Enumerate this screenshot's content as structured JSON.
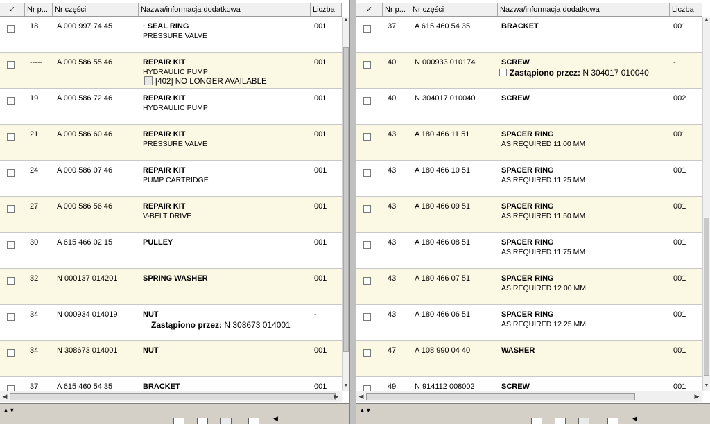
{
  "columns": {
    "check": "✓",
    "pos": "Nr p...",
    "num": "Nr części",
    "name": "Nazwa/informacja dodatkowa",
    "qty": "Liczba"
  },
  "note_label": "Zastąpiono przez:",
  "left_rows": [
    {
      "pos": "18",
      "num": "A 000 997 74 45",
      "name": "· SEAL RING",
      "info": "PRESSURE VALVE",
      "qty": "001"
    },
    {
      "pos": "-----",
      "num": "A 000 586 55 46",
      "name": "REPAIR KIT",
      "info": "HYDRAULIC PUMP",
      "qty": "001",
      "notice": "[402] NO LONGER AVAILABLE"
    },
    {
      "pos": "19",
      "num": "A 000 586 72 46",
      "name": "REPAIR KIT",
      "info": "HYDRAULIC PUMP",
      "qty": "001"
    },
    {
      "pos": "21",
      "num": "A 000 586 60 46",
      "name": "REPAIR KIT",
      "info": "PRESSURE VALVE",
      "qty": "001"
    },
    {
      "pos": "24",
      "num": "A 000 586 07 46",
      "name": "REPAIR KIT",
      "info": "PUMP CARTRIDGE",
      "qty": "001"
    },
    {
      "pos": "27",
      "num": "A 000 586 56 46",
      "name": "REPAIR KIT",
      "info": "V-BELT DRIVE",
      "qty": "001"
    },
    {
      "pos": "30",
      "num": "A 615 466 02 15",
      "name": "PULLEY",
      "info": "",
      "qty": "001"
    },
    {
      "pos": "32",
      "num": "N 000137 014201",
      "name": "SPRING WASHER",
      "info": "",
      "qty": "001"
    },
    {
      "pos": "34",
      "num": "N 000934 014019",
      "name": "NUT",
      "info": "",
      "qty": "-",
      "replaced": "N 308673 014001"
    },
    {
      "pos": "34",
      "num": "N 308673 014001",
      "name": "NUT",
      "info": "",
      "qty": "001"
    },
    {
      "pos": "37",
      "num": "A 615 460 54 35",
      "name": "BRACKET",
      "info": "",
      "qty": "001"
    }
  ],
  "right_rows": [
    {
      "pos": "37",
      "num": "A 615 460 54 35",
      "name": "BRACKET",
      "info": "",
      "qty": "001"
    },
    {
      "pos": "40",
      "num": "N 000933 010174",
      "name": "SCREW",
      "info": "",
      "qty": "-",
      "replaced": "N 304017 010040"
    },
    {
      "pos": "40",
      "num": "N 304017 010040",
      "name": "SCREW",
      "info": "",
      "qty": "002"
    },
    {
      "pos": "43",
      "num": "A 180 466 11 51",
      "name": "SPACER RING",
      "info": "AS REQUIRED 11.00 MM",
      "qty": "001"
    },
    {
      "pos": "43",
      "num": "A 180 466 10 51",
      "name": "SPACER RING",
      "info": "AS REQUIRED 11.25 MM",
      "qty": "001"
    },
    {
      "pos": "43",
      "num": "A 180 466 09 51",
      "name": "SPACER RING",
      "info": "AS REQUIRED 11.50 MM",
      "qty": "001"
    },
    {
      "pos": "43",
      "num": "A 180 466 08 51",
      "name": "SPACER RING",
      "info": "AS REQUIRED 11.75 MM",
      "qty": "001"
    },
    {
      "pos": "43",
      "num": "A 180 466 07 51",
      "name": "SPACER RING",
      "info": "AS REQUIRED 12.00 MM",
      "qty": "001"
    },
    {
      "pos": "43",
      "num": "A 180 466 06 51",
      "name": "SPACER RING",
      "info": "AS REQUIRED 12.25 MM",
      "qty": "001"
    },
    {
      "pos": "47",
      "num": "A 108 990 04 40",
      "name": "WASHER",
      "info": "",
      "qty": "001"
    },
    {
      "pos": "49",
      "num": "N 914112 008002",
      "name": "SCREW",
      "info": "",
      "qty": "001"
    }
  ],
  "icons": {
    "sort": "sort-arrows-icon",
    "checkbox": "checkbox-icon",
    "doc": "document-icon"
  }
}
